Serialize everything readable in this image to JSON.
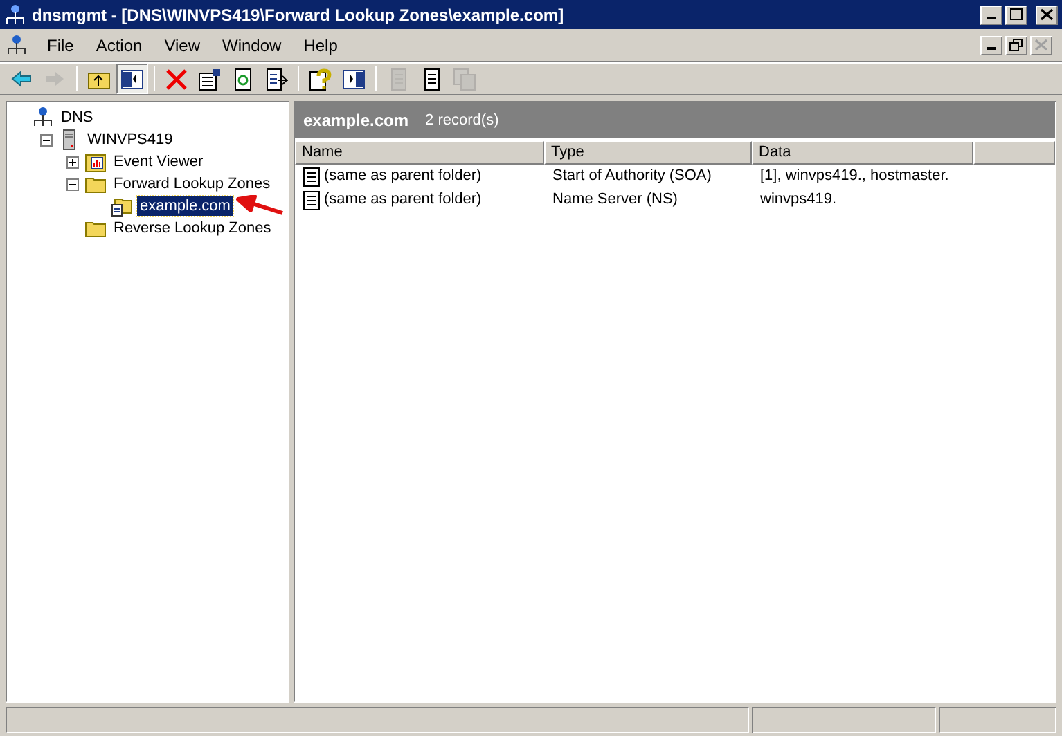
{
  "window": {
    "title": "dnsmgmt - [DNS\\WINVPS419\\Forward Lookup Zones\\example.com]"
  },
  "menu": [
    "File",
    "Action",
    "View",
    "Window",
    "Help"
  ],
  "toolbar": [
    {
      "kind": "back",
      "disabled": false
    },
    {
      "kind": "forward",
      "disabled": true
    },
    {
      "kind": "sep"
    },
    {
      "kind": "up",
      "disabled": false
    },
    {
      "kind": "tree",
      "disabled": false,
      "selected": true
    },
    {
      "kind": "sep"
    },
    {
      "kind": "delete",
      "disabled": false
    },
    {
      "kind": "properties",
      "disabled": false
    },
    {
      "kind": "refresh",
      "disabled": false
    },
    {
      "kind": "export",
      "disabled": false
    },
    {
      "kind": "sep"
    },
    {
      "kind": "help",
      "disabled": false
    },
    {
      "kind": "panel",
      "disabled": false
    },
    {
      "kind": "sep"
    },
    {
      "kind": "doc",
      "disabled": true
    },
    {
      "kind": "doc",
      "disabled": false
    },
    {
      "kind": "docs",
      "disabled": true
    }
  ],
  "tree": [
    {
      "label": "DNS",
      "kind": "dns",
      "selected": false,
      "children": [
        {
          "label": "WINVPS419",
          "kind": "server",
          "selected": false,
          "expanded": true,
          "children": [
            {
              "label": "Event Viewer",
              "kind": "events",
              "selected": false,
              "expanded": false
            },
            {
              "label": "Forward Lookup Zones",
              "kind": "folder",
              "selected": false,
              "expanded": true,
              "children": [
                {
                  "label": "example.com",
                  "kind": "zone",
                  "selected": true
                }
              ]
            },
            {
              "label": "Reverse Lookup Zones",
              "kind": "folder",
              "selected": false
            }
          ]
        }
      ]
    }
  ],
  "header": {
    "title": "example.com",
    "count": "2 record(s)"
  },
  "table": {
    "columns": [
      "Name",
      "Type",
      "Data"
    ],
    "rows": [
      [
        "(same as parent folder)",
        "Start of Authority (SOA)",
        "[1], winvps419., hostmaster."
      ],
      [
        "(same as parent folder)",
        "Name Server (NS)",
        "winvps419."
      ]
    ]
  }
}
